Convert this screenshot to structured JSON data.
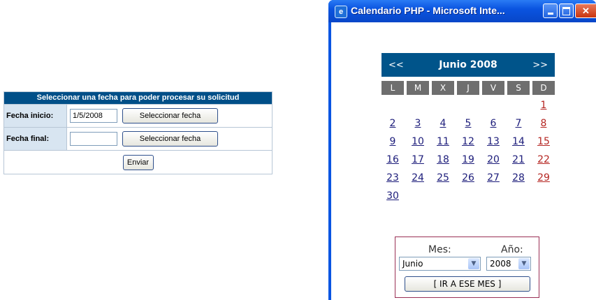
{
  "form": {
    "header": "Seleccionar una fecha para poder procesar su solicitud",
    "rows": [
      {
        "label": "Fecha inicio:",
        "value": "1/5/2008",
        "button": "Seleccionar fecha"
      },
      {
        "label": "Fecha final:",
        "value": "",
        "button": "Seleccionar fecha"
      }
    ],
    "submit": "Enviar"
  },
  "window": {
    "title": "Calendario PHP - Microsoft Inte...",
    "icon": "ie-icon",
    "buttons": {
      "minimize": "minimize-icon",
      "maximize": "maximize-icon",
      "close": "✕"
    }
  },
  "calendar": {
    "prev": "<<",
    "next": ">>",
    "month_label": "Junio 2008",
    "weekdays": [
      "L",
      "M",
      "X",
      "J",
      "V",
      "S",
      "D"
    ],
    "weeks": [
      [
        "",
        "",
        "",
        "",
        "",
        "",
        "1"
      ],
      [
        "2",
        "3",
        "4",
        "5",
        "6",
        "7",
        "8"
      ],
      [
        "9",
        "10",
        "11",
        "12",
        "13",
        "14",
        "15"
      ],
      [
        "16",
        "17",
        "18",
        "19",
        "20",
        "21",
        "22"
      ],
      [
        "23",
        "24",
        "25",
        "26",
        "27",
        "28",
        "29"
      ],
      [
        "30",
        "",
        "",
        "",
        "",
        "",
        ""
      ]
    ],
    "selector": {
      "mes_label": "Mes:",
      "ano_label": "Año:",
      "mes_value": "Junio",
      "ano_value": "2008",
      "go_button": "[ IR A ESE MES ]"
    }
  },
  "colors": {
    "header_blue": "#004f88",
    "calendar_blue": "#00548a",
    "sunday_red": "#b52622",
    "xp_blue": "#0a55e2"
  }
}
